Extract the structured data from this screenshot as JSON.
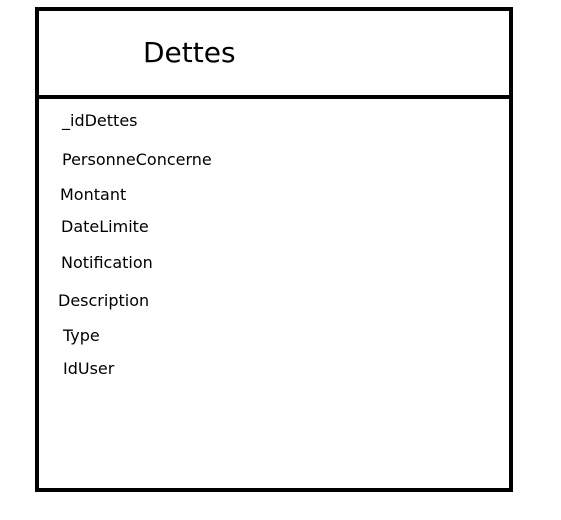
{
  "entity": {
    "title": "Dettes",
    "attributes": [
      "_idDettes",
      "PersonneConcerne",
      "Montant",
      "DateLimite",
      "Notification",
      "Description",
      "Type",
      "IdUser"
    ]
  }
}
